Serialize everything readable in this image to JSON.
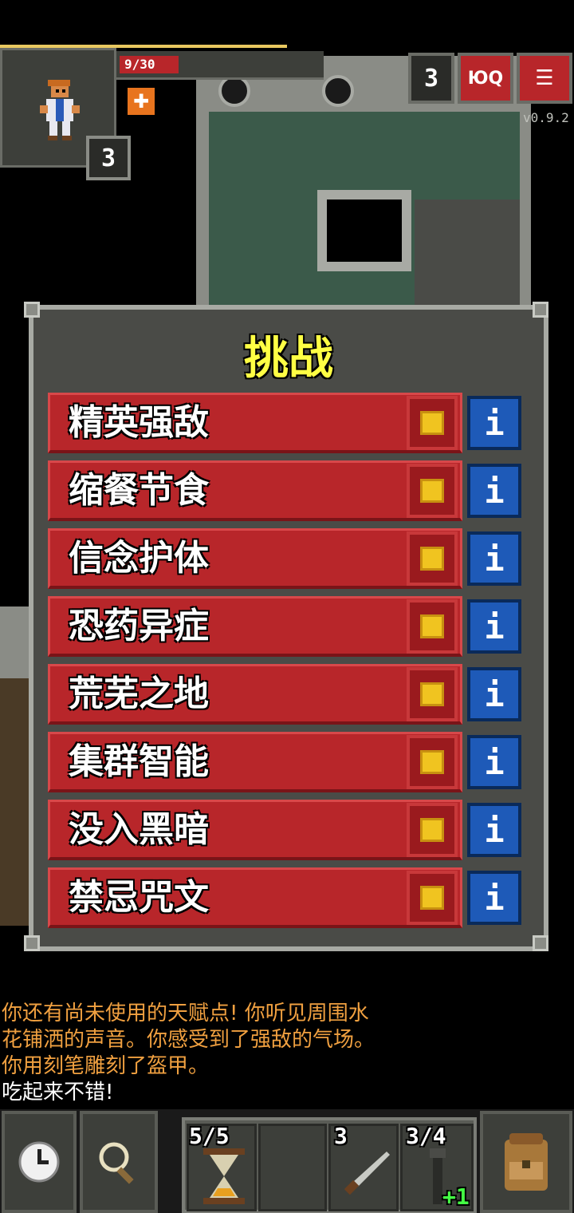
{
  "hero": {
    "hp_text": "9/30",
    "level": "3"
  },
  "header": {
    "depth": "3",
    "journal_label": "ЮQ",
    "menu_label": "☰",
    "version": "v0.9.2"
  },
  "window": {
    "title": "挑战",
    "challenges": [
      {
        "label": "精英强敌",
        "checked": true
      },
      {
        "label": "缩餐节食",
        "checked": true
      },
      {
        "label": "信念护体",
        "checked": true
      },
      {
        "label": "恐药异症",
        "checked": true
      },
      {
        "label": "荒芜之地",
        "checked": true
      },
      {
        "label": "集群智能",
        "checked": true
      },
      {
        "label": "没入黑暗",
        "checked": true
      },
      {
        "label": "禁忌咒文",
        "checked": true
      }
    ],
    "info_label": "i"
  },
  "log": {
    "line1": "你还有尚未使用的天赋点!  你听见周围水",
    "line2": "花铺洒的声音。你感受到了强敌的气场。",
    "line3": "你用刻笔雕刻了盔甲。",
    "line4": "吃起来不错!"
  },
  "colors": {
    "log_orange": "#f0a040",
    "log_white": "#ffffff",
    "title_yellow": "#ffff44"
  },
  "toolbar": {
    "slot1_count": "5/5",
    "slot3_count": "3",
    "slot4_count": "3/4",
    "slot4_bonus": "+1"
  }
}
